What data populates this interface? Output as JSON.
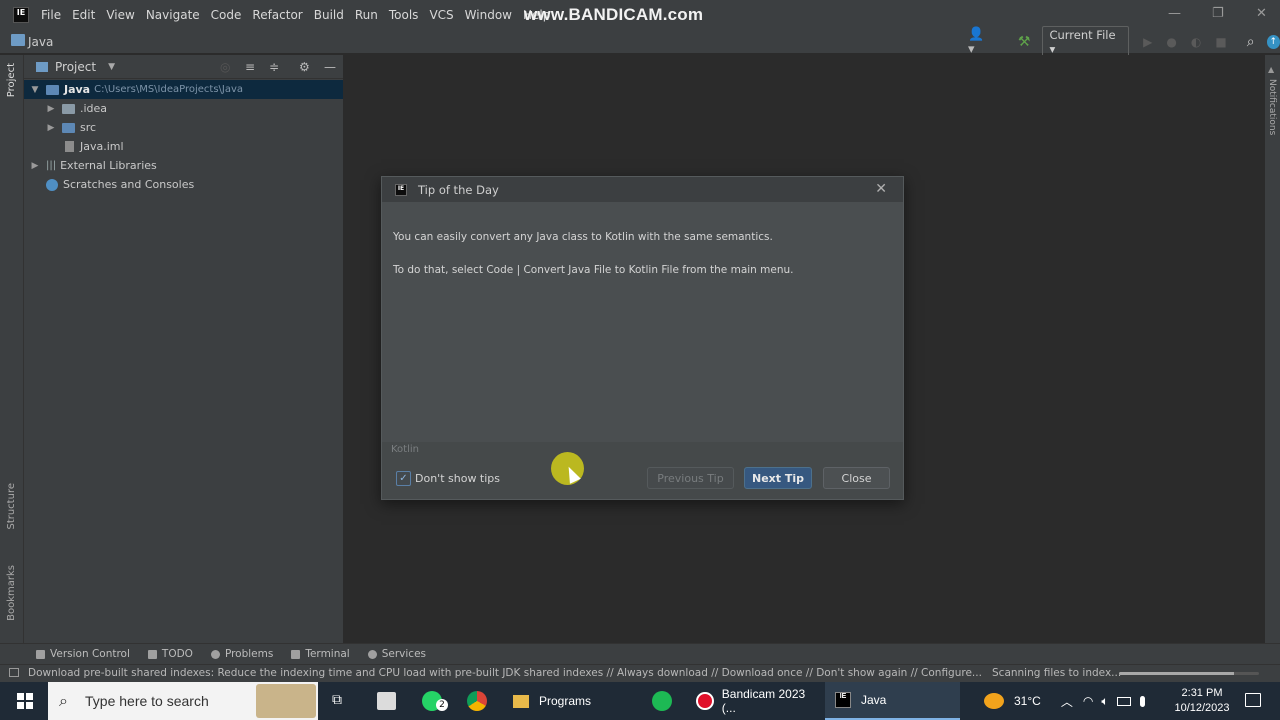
{
  "menu": {
    "items": [
      "File",
      "Edit",
      "View",
      "Navigate",
      "Code",
      "Refactor",
      "Build",
      "Run",
      "Tools",
      "VCS",
      "Window",
      "Help"
    ],
    "watermark": "www.BANDICAM.com",
    "logo": "IE"
  },
  "navbar": {
    "breadcrumb": "Java",
    "run_config": "Current File"
  },
  "sidestrip": {
    "project": "Project",
    "structure": "Structure",
    "bookmarks": "Bookmarks",
    "notifications": "Notifications"
  },
  "project_panel": {
    "title": "Project",
    "root_name": "Java",
    "root_path": "C:\\Users\\MS\\IdeaProjects\\Java",
    "items": [
      ".idea",
      "src",
      "Java.iml",
      "External Libraries",
      "Scratches and Consoles"
    ]
  },
  "dialog": {
    "title": "Tip of the Day",
    "tip_line1": "You can easily convert any Java class to Kotlin with the same semantics.",
    "tip_line2": "To do that, select Code | Convert Java File to Kotlin File from the main menu.",
    "category": "Kotlin",
    "dont_show_label": "Don't show tips",
    "dont_show_checked": true,
    "prev_label": "Previous Tip",
    "next_label": "Next Tip",
    "close_label": "Close"
  },
  "bottom_tabs": [
    "Version Control",
    "TODO",
    "Problems",
    "Terminal",
    "Services"
  ],
  "status": {
    "message": "Download pre-built shared indexes: Reduce the indexing time and CPU load with pre-built JDK shared indexes // Always download // Download once // Don't show again // Configure...",
    "scanning": "Scanning files to index...",
    "progress": 0.82
  },
  "taskbar": {
    "search_placeholder": "Type here to search",
    "whatsapp_badge": "2",
    "apps": [
      "Programs",
      "Bandicam 2023 (...",
      "Java"
    ],
    "temperature": "31°C",
    "time": "2:31 PM",
    "date": "10/12/2023"
  },
  "colors": {
    "accent": "#365880",
    "selection": "#0d293e",
    "cursor_highlight": "#c8c41c"
  }
}
